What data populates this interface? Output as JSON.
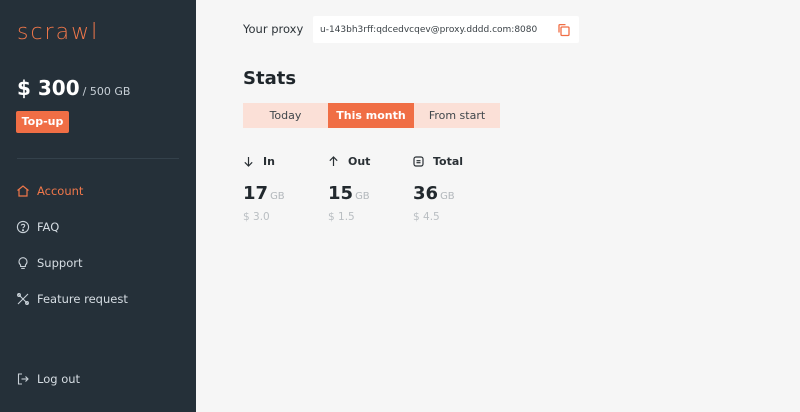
{
  "app": {
    "logo": "scrawl"
  },
  "balance": {
    "amount": "$ 300",
    "quota": "/ 500 GB",
    "topup_label": "Top-up"
  },
  "nav": {
    "items": [
      {
        "label": "Account",
        "icon": "home-icon",
        "active": true
      },
      {
        "label": "FAQ",
        "icon": "question-circle-icon"
      },
      {
        "label": "Support",
        "icon": "lightbulb-icon"
      },
      {
        "label": "Feature request",
        "icon": "tools-icon"
      }
    ],
    "logout_label": "Log out"
  },
  "proxy": {
    "label": "Your proxy",
    "value": "u-143bh3rff:qdcedvcqev@proxy.dddd.com:8080"
  },
  "stats": {
    "title": "Stats",
    "tabs": [
      {
        "label": "Today"
      },
      {
        "label": "This month",
        "active": true
      },
      {
        "label": "From start"
      }
    ],
    "cards": [
      {
        "label": "In",
        "icon": "arrow-down-icon",
        "value": "17",
        "unit": "GB",
        "cost": "$ 3.0"
      },
      {
        "label": "Out",
        "icon": "arrow-up-icon",
        "value": "15",
        "unit": "GB",
        "cost": "$ 1.5"
      },
      {
        "label": "Total",
        "icon": "total-icon",
        "value": "36",
        "unit": "GB",
        "cost": "$ 4.5"
      }
    ]
  },
  "colors": {
    "accent": "#f06e45",
    "sidebar": "#253039",
    "tab_inactive": "#fbe0d7",
    "background": "#f6f6f6"
  }
}
